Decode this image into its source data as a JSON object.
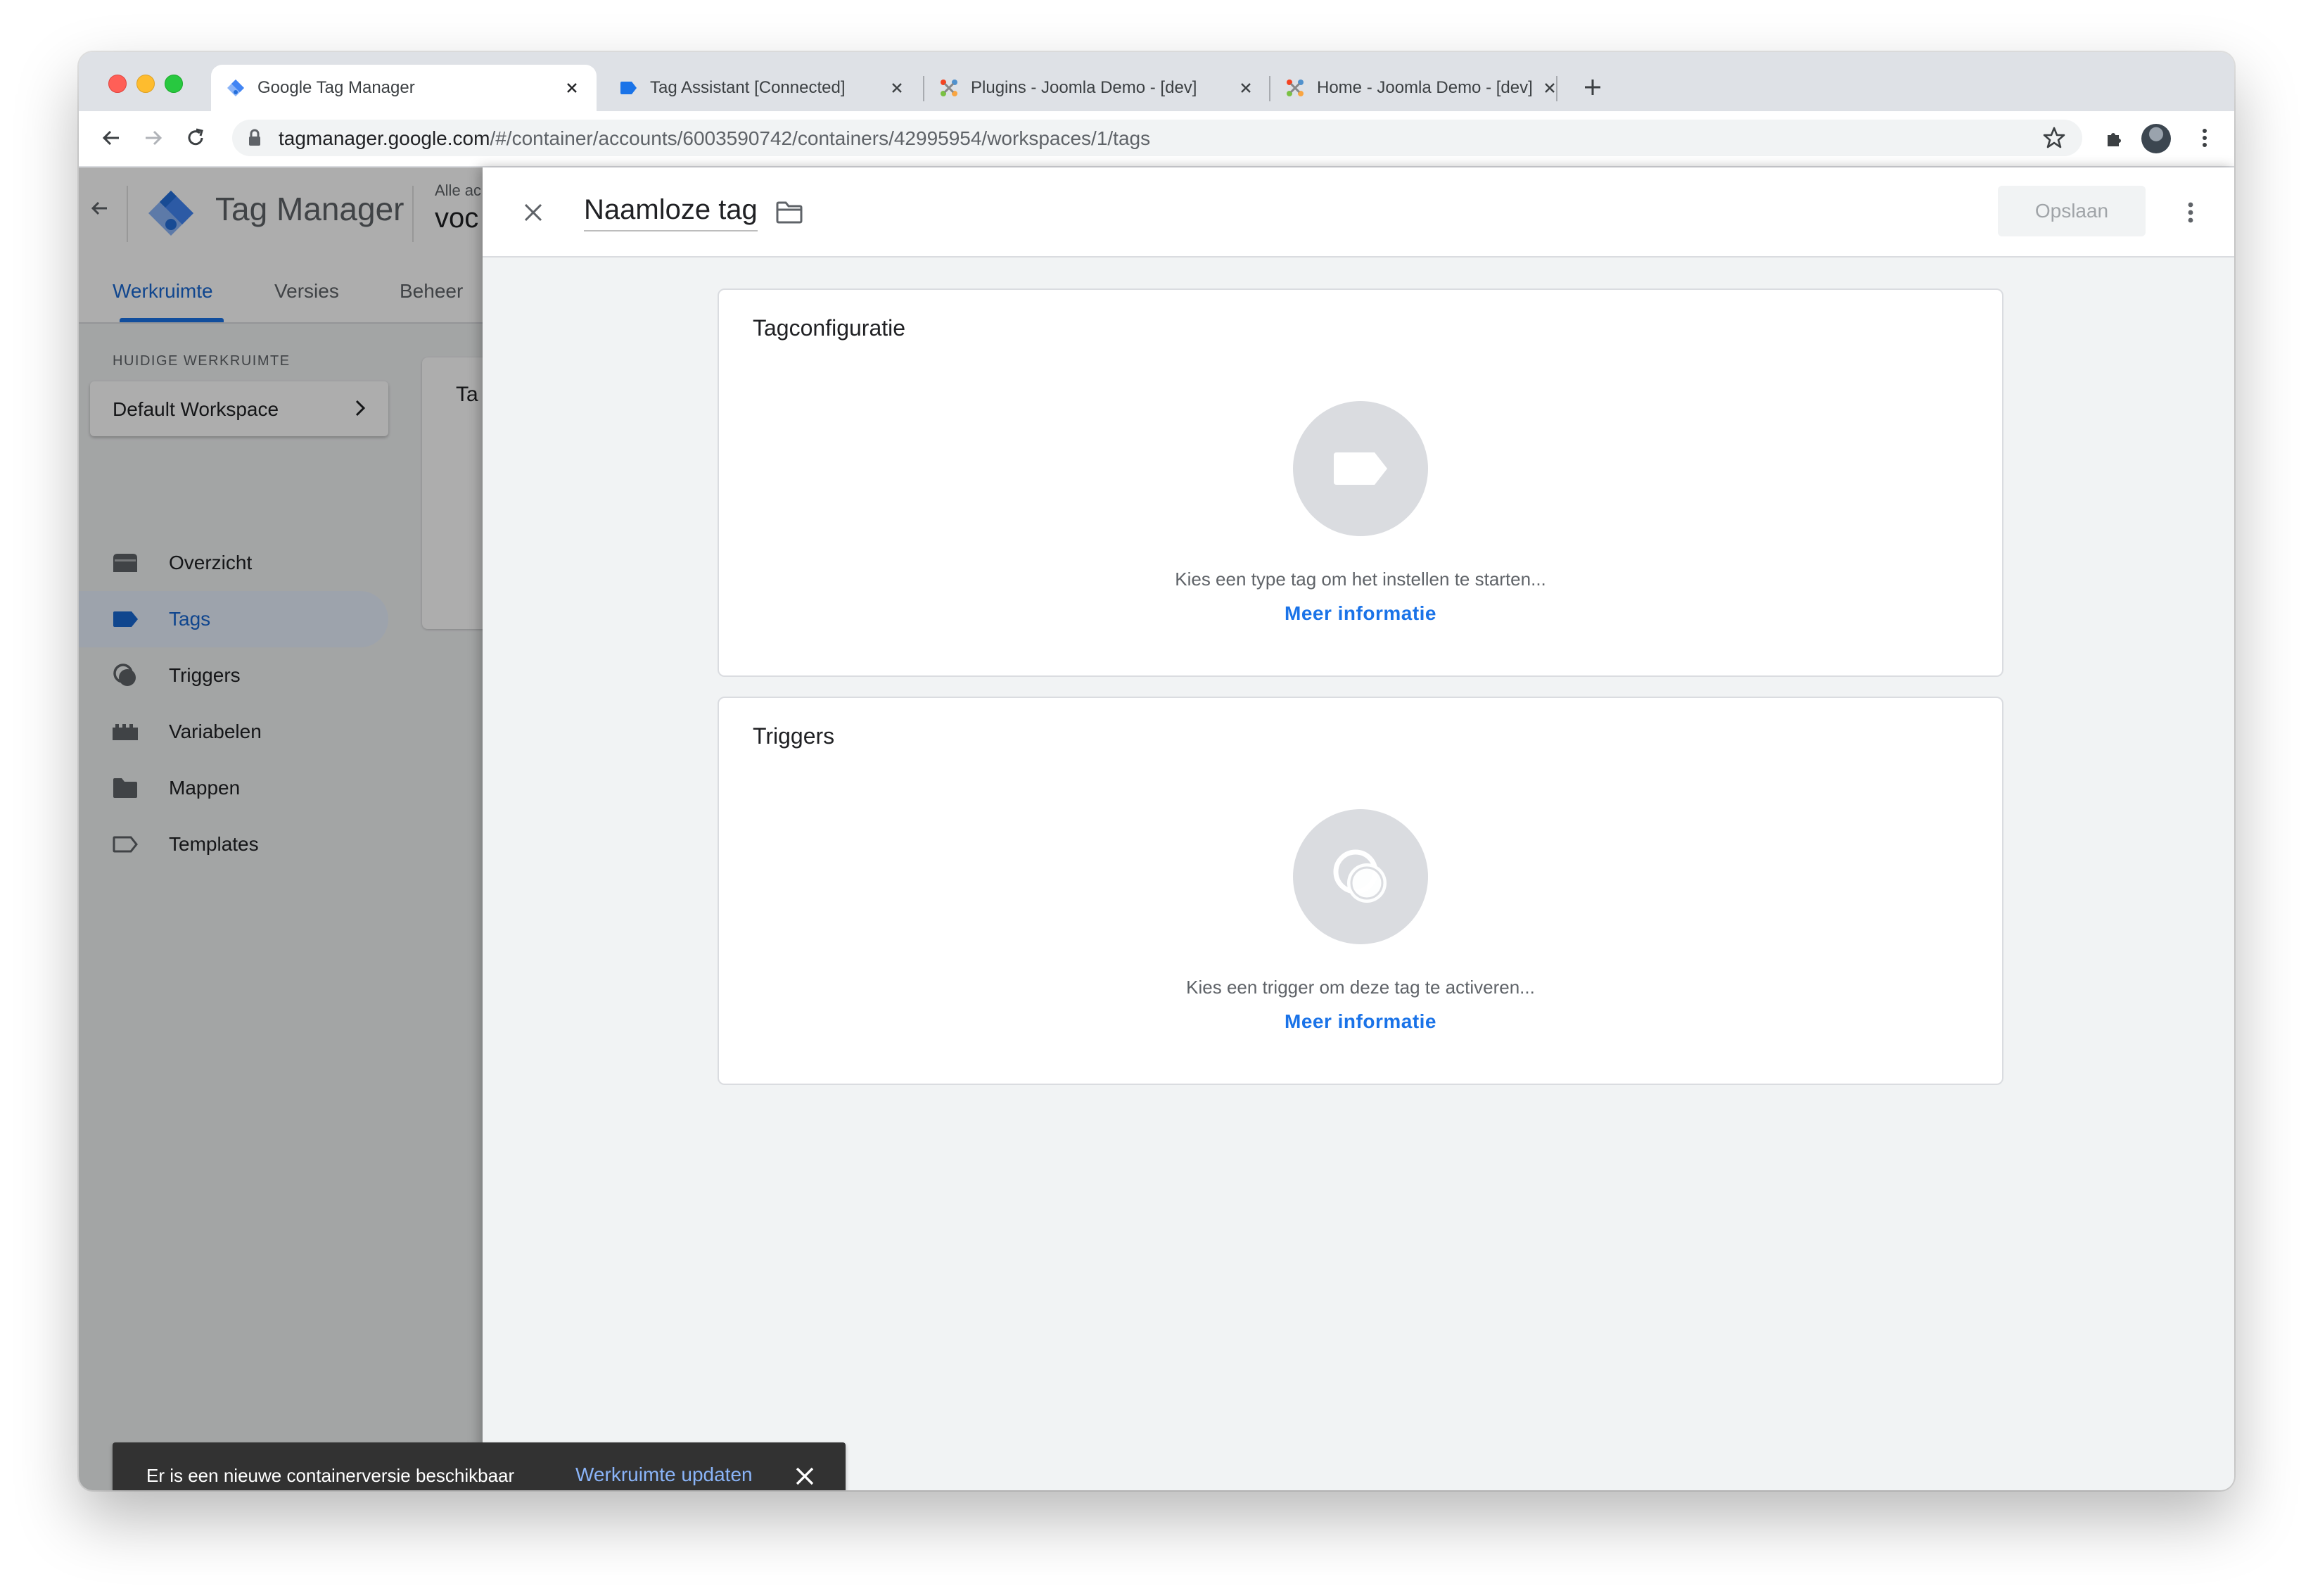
{
  "browser": {
    "tabs": [
      {
        "title": "Google Tag Manager",
        "favicon": "gtm-icon"
      },
      {
        "title": "Tag Assistant [Connected]",
        "favicon": "tag-assistant-icon"
      },
      {
        "title": "Plugins - Joomla Demo - [dev]",
        "favicon": "joomla-icon"
      },
      {
        "title": "Home - Joomla Demo - [dev]",
        "favicon": "joomla-icon"
      }
    ],
    "url_host": "tagmanager.google.com",
    "url_path": "/#/container/accounts/6003590742/containers/42995954/workspaces/1/tags"
  },
  "gtm": {
    "brand": "Tag Manager",
    "account_label": "Alle ac",
    "account_name": "voc",
    "nav_tabs": [
      "Werkruimte",
      "Versies",
      "Beheer"
    ],
    "workspace_label": "HUIDIGE WERKRUIMTE",
    "workspace_name": "Default Workspace",
    "sidebar": [
      {
        "label": "Overzicht",
        "icon": "overview-icon"
      },
      {
        "label": "Tags",
        "icon": "tag-icon"
      },
      {
        "label": "Triggers",
        "icon": "trigger-icon"
      },
      {
        "label": "Variabelen",
        "icon": "variables-icon"
      },
      {
        "label": "Mappen",
        "icon": "folder-icon"
      },
      {
        "label": "Templates",
        "icon": "template-icon"
      }
    ],
    "selected_sidebar": "Tags",
    "background_card_title": "Ta"
  },
  "editor": {
    "tag_name": "Naamloze tag",
    "save_label": "Opslaan",
    "config_card": {
      "title": "Tagconfiguratie",
      "hint": "Kies een type tag om het instellen te starten...",
      "link": "Meer informatie"
    },
    "triggers_card": {
      "title": "Triggers",
      "hint": "Kies een trigger om deze tag te activeren...",
      "link": "Meer informatie"
    }
  },
  "snackbar": {
    "message": "Er is een nieuwe containerversie beschikbaar",
    "action": "Werkruimte updaten"
  },
  "colors": {
    "accent": "#1a73e8",
    "selected_bg": "#e8f0fe",
    "snackbar_bg": "#323232",
    "snackbar_action": "#8ab4f8"
  }
}
